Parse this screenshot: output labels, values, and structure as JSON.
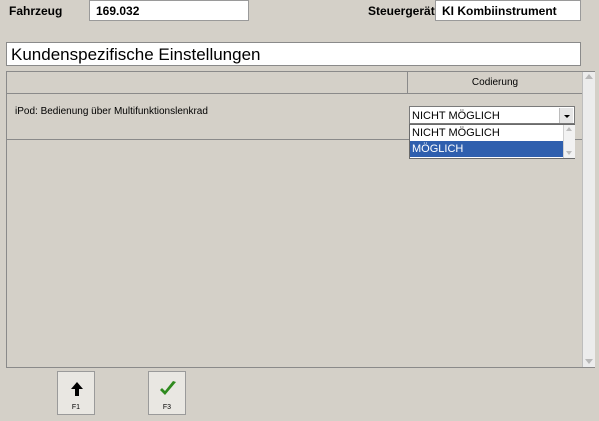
{
  "header": {
    "vehicle_label": "Fahrzeug",
    "vehicle_value": "169.032",
    "ecu_label": "Steuergerät",
    "ecu_value": "KI Kombiinstrument"
  },
  "title": "Kundenspezifische Einstellungen",
  "table": {
    "column_header": "Codierung",
    "rows": [
      {
        "label": "iPod: Bedienung über Multifunktionslenkrad",
        "value": "NICHT MÖGLICH"
      }
    ]
  },
  "dropdown": {
    "options": [
      "NICHT MÖGLICH",
      "MÖGLICH"
    ],
    "highlighted": "MÖGLICH"
  },
  "function_keys": [
    {
      "label": "F1",
      "icon": "up-arrow-icon"
    },
    {
      "label": "F3",
      "icon": "checkmark-icon"
    }
  ],
  "colors": {
    "highlight": "#2f5fae",
    "checkmark": "#2f8a1e"
  }
}
